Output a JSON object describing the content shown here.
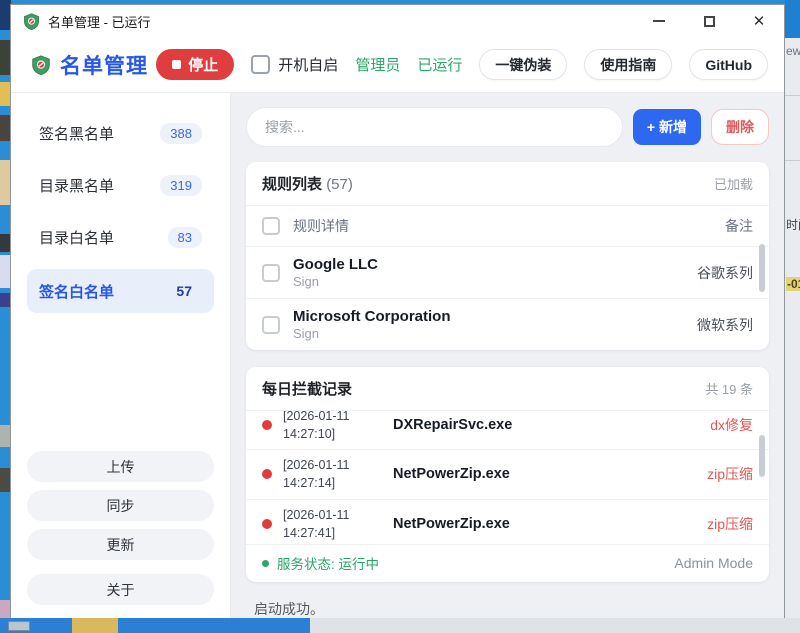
{
  "colors": {
    "brand": "#2757e6",
    "accent": "#2e68f0",
    "danger": "#e03e3e",
    "success": "#2aa865",
    "tag_red": "#e25555"
  },
  "titlebar": {
    "title": "名单管理 - 已运行"
  },
  "header": {
    "app_name": "名单管理",
    "stop_label": "停止",
    "autostart_label": "开机自启",
    "admin_label": "管理员",
    "running_label": "已运行",
    "disguise_label": "一键伪装",
    "guide_label": "使用指南",
    "github_label": "GitHub"
  },
  "sidebar": {
    "items": [
      {
        "label": "签名黑名单",
        "count": "388",
        "selected": false
      },
      {
        "label": "目录黑名单",
        "count": "319",
        "selected": false
      },
      {
        "label": "目录白名单",
        "count": "83",
        "selected": false
      },
      {
        "label": "签名白名单",
        "count": "57",
        "selected": true
      }
    ],
    "actions": [
      {
        "label": "上传"
      },
      {
        "label": "同步"
      },
      {
        "label": "更新"
      },
      {
        "label": "关于"
      }
    ]
  },
  "main": {
    "search_placeholder": "搜索...",
    "add_label": "+ 新增",
    "delete_label": "删除",
    "rules_panel": {
      "title": "规则列表",
      "count": "(57)",
      "status": "已加载",
      "col_detail": "规则详情",
      "col_note": "备注",
      "rows": [
        {
          "name": "Google LLC",
          "type": "Sign",
          "note": "谷歌系列"
        },
        {
          "name": "Microsoft Corporation",
          "type": "Sign",
          "note": "微软系列"
        }
      ]
    },
    "log_panel": {
      "title": "每日拦截记录",
      "count": "共 19 条",
      "rows": [
        {
          "date": "[2026-01-11",
          "time": "14:27:10]",
          "name": "DXRepairSvc.exe",
          "tag": "dx修复"
        },
        {
          "date": "[2026-01-11",
          "time": "14:27:14]",
          "name": "NetPowerZip.exe",
          "tag": "zip压缩"
        },
        {
          "date": "[2026-01-11",
          "time": "14:27:41]",
          "name": "NetPowerZip.exe",
          "tag": "zip压缩"
        }
      ],
      "service_status": "服务状态: 运行中",
      "mode": "Admin Mode"
    },
    "footer_status": "启动成功。"
  },
  "background": {
    "fragments": {
      "f1": "ew",
      "f2": "时间",
      "f3": "-01"
    }
  }
}
